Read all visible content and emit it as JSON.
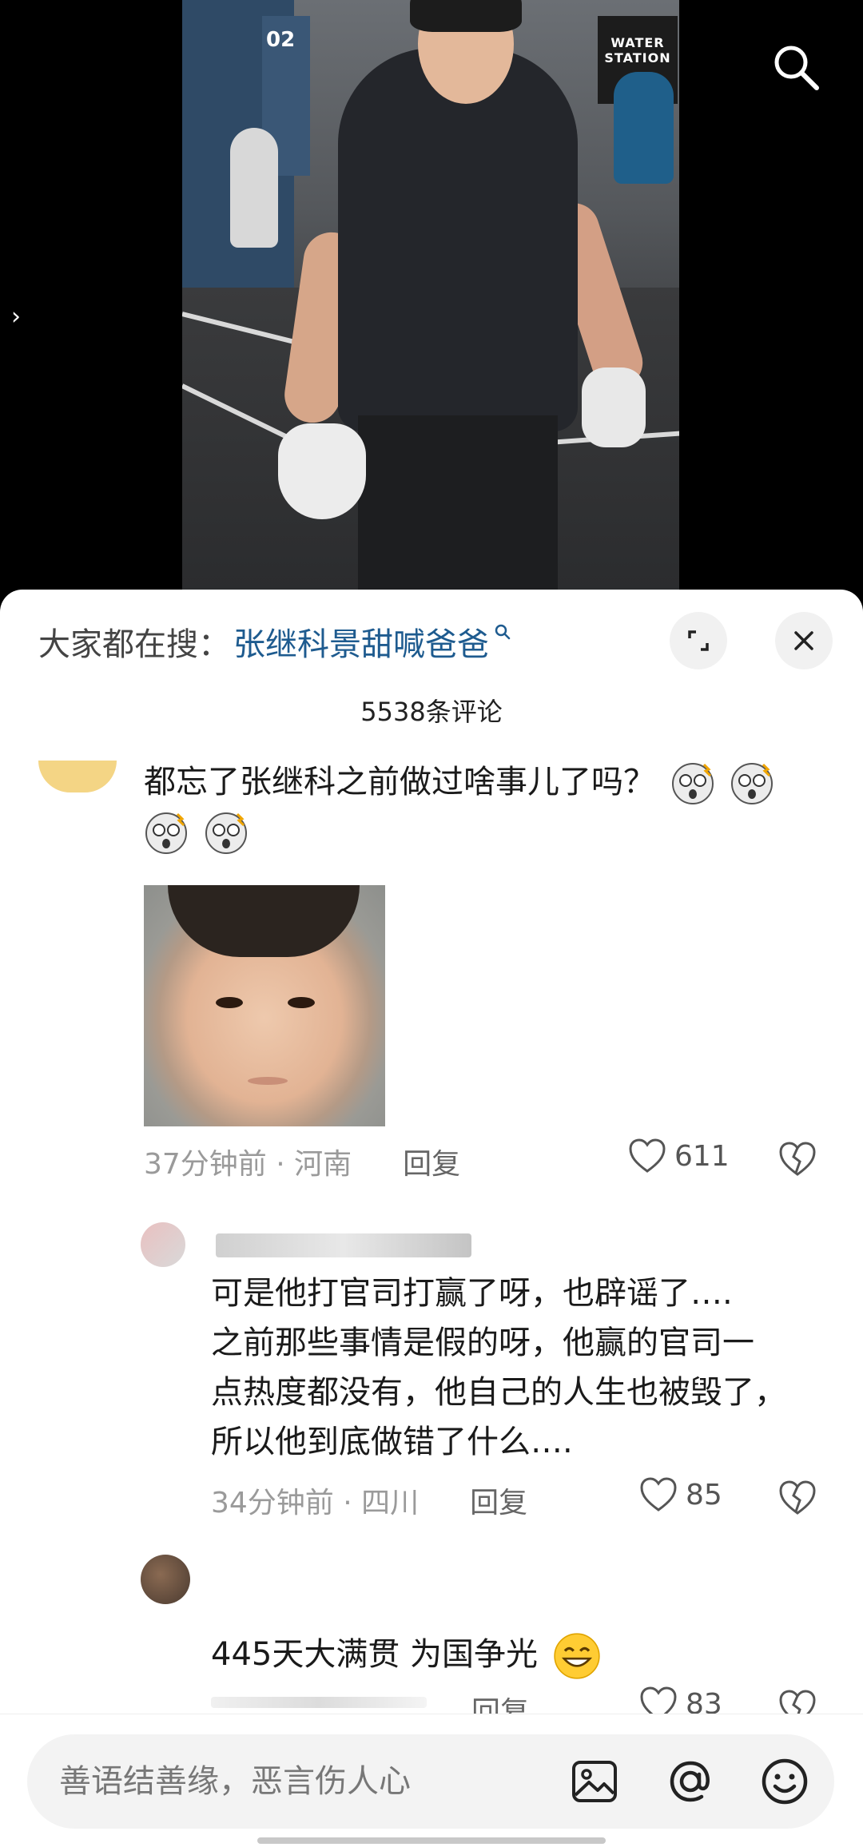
{
  "video": {
    "sign_text": "WATER STATION",
    "jersey_number": "02",
    "search_icon": "search-icon",
    "side_icon": "chevron-right-icon"
  },
  "sheet": {
    "search_prefix": "大家都在搜：",
    "search_term": "张继科景甜喊爸爸",
    "comment_count": "5538条评论"
  },
  "comments": [
    {
      "text_line1": "都忘了张继科之前做过啥事儿了吗？",
      "emoji": "shocked-face-emoji",
      "time_location": "37分钟前 · 河南",
      "reply_label": "回复",
      "likes": "611",
      "has_image": true
    },
    {
      "lines": [
        "可是他打官司打赢了呀，也辟谣了….",
        "之前那些事情是假的呀，他赢的官司一",
        "点热度都没有，他自己的人生也被毁了，",
        "所以他到底做错了什么…."
      ],
      "time_location": "34分钟前 · 四川",
      "reply_label": "回复",
      "likes": "85"
    },
    {
      "text": "445天大满贯 为国争光",
      "emoji": "grinning-face-emoji",
      "reply_label": "回复",
      "likes": "83"
    }
  ],
  "input": {
    "placeholder": "善语结善缘，恶言伤人心",
    "icons": [
      "image-icon",
      "at-icon",
      "emoji-icon"
    ]
  },
  "colors": {
    "search_term": "#1e5b8f",
    "meta": "#9a9a9a",
    "sheet_bg": "#ffffff"
  }
}
